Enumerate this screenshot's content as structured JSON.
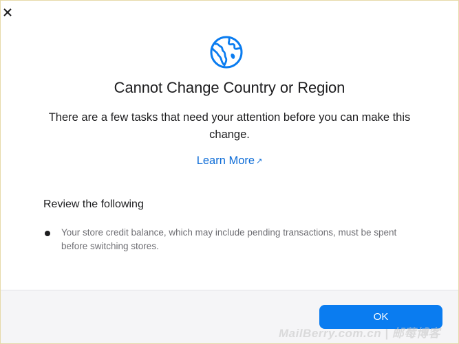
{
  "dialog": {
    "close_icon": "close-icon",
    "header_icon": "globe-icon",
    "title": "Cannot Change Country or Region",
    "message": "There are a few tasks that need your attention before you can make this change.",
    "learn_more": "Learn More",
    "learn_more_icon": "external-arrow-icon",
    "review_heading": "Review the following",
    "review_items": [
      "Your store credit balance, which may include pending transactions, must be spent before switching stores."
    ],
    "ok_label": "OK"
  },
  "watermark": "MailBerry.com.cn | 邮莓博客",
  "colors": {
    "accent": "#0a7cf0",
    "link": "#0a6ad6",
    "text": "#1d1d1f",
    "secondary_text": "#6e6e73",
    "footer_bg": "#f5f5f7"
  }
}
